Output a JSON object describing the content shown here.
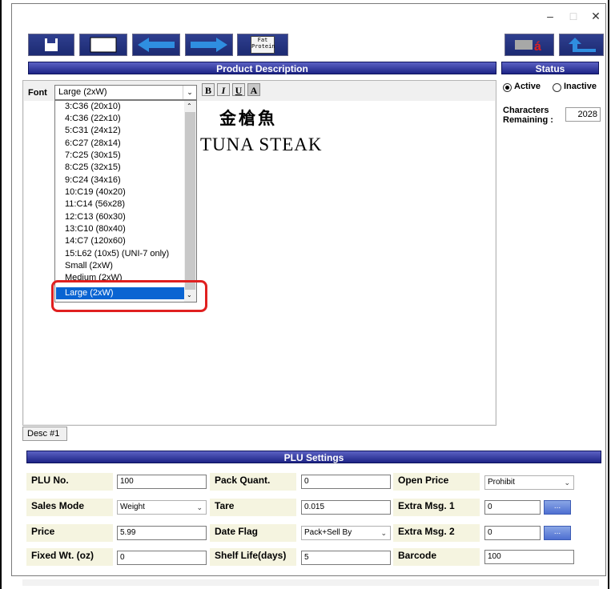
{
  "window": {
    "minimize_glyph": "–",
    "maximize_glyph": "□",
    "close_glyph": "✕"
  },
  "toolbar": {
    "fat_label": "Fat",
    "fat_sub": "Protein"
  },
  "headers": {
    "product_description": "Product Description",
    "status": "Status",
    "plu_settings": "PLU Settings"
  },
  "font": {
    "label": "Font",
    "selected": "Large (2xW)",
    "bold": "B",
    "italic": "I",
    "underline": "U",
    "reverse": "A",
    "options": [
      "3:C36 (20x10)",
      "4:C36 (22x10)",
      "5:C31 (24x12)",
      "6:C27 (28x14)",
      "7:C25 (30x15)",
      "8:C25 (32x15)",
      "9:C24 (34x16)",
      "10:C19 (40x20)",
      "11:C14 (56x28)",
      "12:C13 (60x30)",
      "13:C10 (80x40)",
      "14:C7 (120x60)",
      "15:L62 (10x5) (UNI-7 only)",
      "Small (2xW)",
      "Medium (2xW)"
    ],
    "highlighted": "Large (2xW)"
  },
  "description": {
    "line1": "金槍魚",
    "line2": "TUNA  STEAK",
    "tab": "Desc #1"
  },
  "status": {
    "active": "Active",
    "inactive": "Inactive",
    "characters_label_1": "Characters",
    "characters_label_2": "Remaining :",
    "characters_remaining": "2028"
  },
  "plu": {
    "plu_no_label": "PLU No.",
    "plu_no": "100",
    "pack_quant_label": "Pack Quant.",
    "pack_quant": "0",
    "open_price_label": "Open Price",
    "open_price": "Prohibit",
    "sales_mode_label": "Sales Mode",
    "sales_mode": "Weight",
    "tare_label": "Tare",
    "tare": "0.015",
    "extra_msg1_label": "Extra Msg. 1",
    "extra_msg1": "0",
    "price_label": "Price",
    "price": "5.99",
    "date_flag_label": "Date Flag",
    "date_flag": "Pack+Sell By",
    "extra_msg2_label": "Extra Msg. 2",
    "extra_msg2": "0",
    "fixed_wt_label": "Fixed Wt. (oz)",
    "fixed_wt": "0",
    "shelf_life_label": "Shelf Life(days)",
    "shelf_life": "5",
    "barcode_label": "Barcode",
    "barcode": "100",
    "dots": "..."
  },
  "colors": {
    "header_blue": "#1d2486",
    "toolbar_blue": "#1c2a72",
    "selection_blue": "#0a64d2",
    "highlight_red": "#e02020",
    "label_bg": "#f5f4e0"
  }
}
